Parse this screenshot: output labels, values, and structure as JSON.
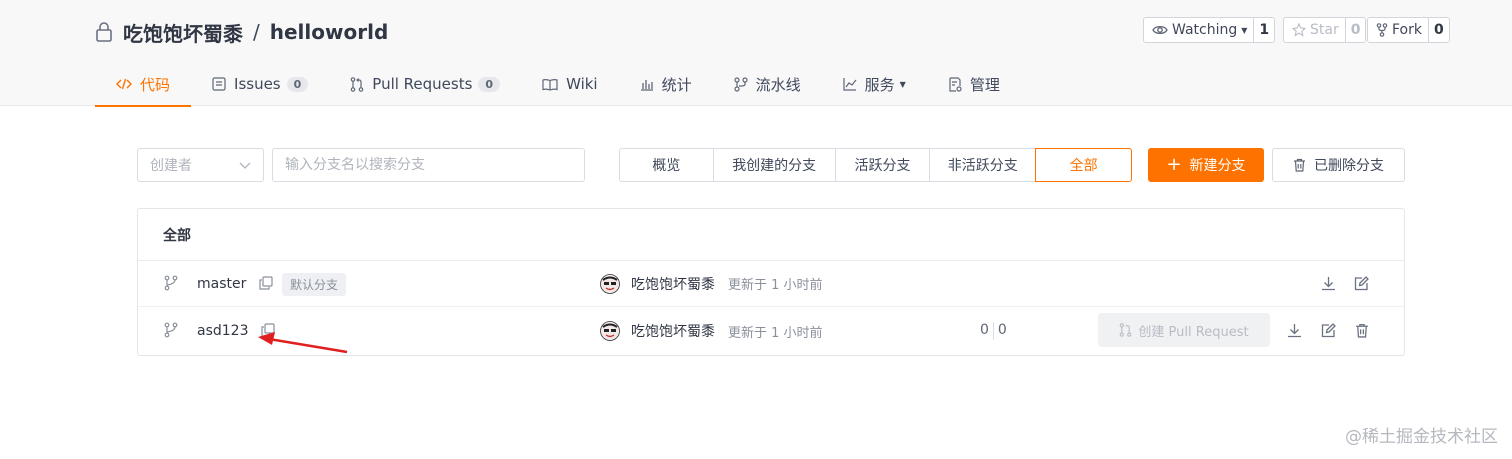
{
  "repo": {
    "owner": "吃饱饱坏蜀黍",
    "separator": "/",
    "name": "helloworld"
  },
  "counters": {
    "watch": {
      "label": "Watching",
      "count": "1"
    },
    "star": {
      "label": "Star",
      "count": "0"
    },
    "fork": {
      "label": "Fork",
      "count": "0"
    }
  },
  "tabs": [
    {
      "label": "代码",
      "icon": "code-icon",
      "active": true
    },
    {
      "label": "Issues",
      "icon": "issues-icon",
      "badge": "0"
    },
    {
      "label": "Pull Requests",
      "icon": "pull-request-icon",
      "badge": "0"
    },
    {
      "label": "Wiki",
      "icon": "book-icon"
    },
    {
      "label": "统计",
      "icon": "bar-chart-icon"
    },
    {
      "label": "流水线",
      "icon": "pipeline-icon"
    },
    {
      "label": "服务",
      "icon": "line-chart-icon",
      "dropdown": true
    },
    {
      "label": "管理",
      "icon": "settings-doc-icon"
    }
  ],
  "filters": {
    "creator_placeholder": "创建者",
    "search_placeholder": "输入分支名以搜索分支",
    "segments": [
      "概览",
      "我创建的分支",
      "活跃分支",
      "非活跃分支",
      "全部"
    ],
    "active_segment": "全部",
    "new_branch_label": "新建分支",
    "deleted_branches_label": "已删除分支"
  },
  "branch_panel": {
    "header": "全部",
    "rows": [
      {
        "name": "master",
        "default_tag": "默认分支",
        "author": "吃饱饱坏蜀黍",
        "updated": "更新于 1 小时前"
      },
      {
        "name": "asd123",
        "author": "吃饱饱坏蜀黍",
        "updated": "更新于 1 小时前",
        "behind": "0",
        "ahead": "0",
        "pr_button": "创建 Pull Request"
      }
    ]
  },
  "colors": {
    "accent": "#fe7300",
    "annotation_arrow": "#e02020"
  },
  "watermark": "@稀土掘金技术社区"
}
